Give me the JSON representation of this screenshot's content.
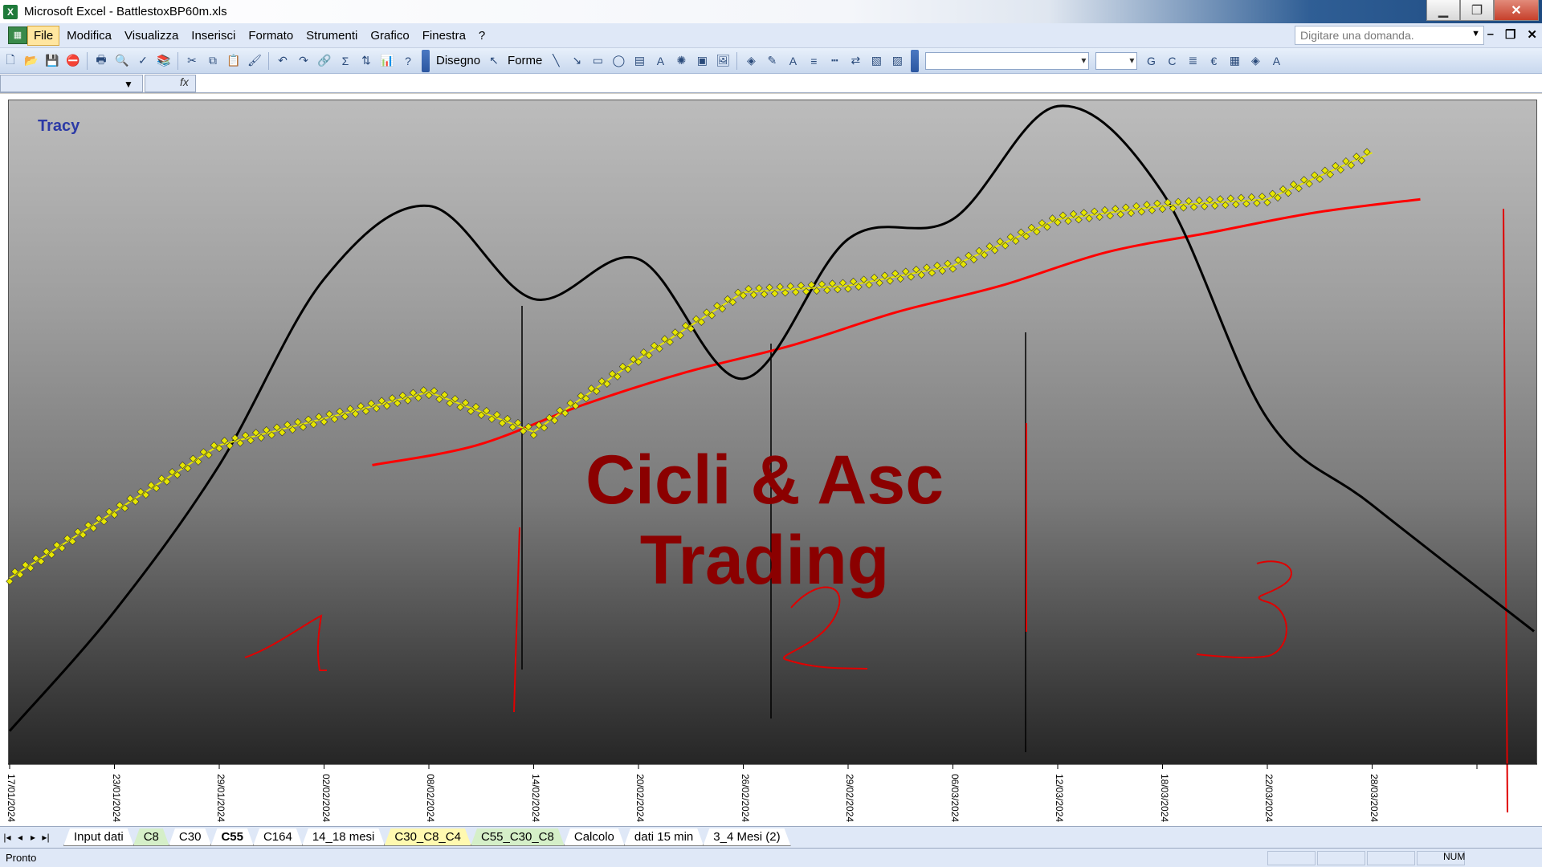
{
  "window": {
    "title": "Microsoft Excel - BattlestoxBP60m.xls",
    "app_icon": "excel-icon"
  },
  "menubar": {
    "items": [
      "File",
      "Modifica",
      "Visualizza",
      "Inserisci",
      "Formato",
      "Strumenti",
      "Grafico",
      "Finestra",
      "?"
    ],
    "ask_placeholder": "Digitare una domanda."
  },
  "toolbar": {
    "draw_label": "Disegno",
    "shapes_label": "Forme"
  },
  "formula": {
    "fx_label": "fx"
  },
  "chart_data": {
    "type": "line",
    "title": "Tracy",
    "watermark_line1": "Cicli & Asc",
    "watermark_line2": "Trading",
    "cycle_labels": [
      "1",
      "2",
      "3"
    ],
    "categories": [
      "17/01/2024",
      "23/01/2024",
      "29/01/2024",
      "02/02/2024",
      "08/02/2024",
      "14/02/2024",
      "20/02/2024",
      "26/02/2024",
      "29/02/2024",
      "06/03/2024",
      "12/03/2024",
      "18/03/2024",
      "22/03/2024",
      "28/03/2024"
    ],
    "series": [
      {
        "name": "",
        "color": "#000000",
        "values": [
          0.05,
          0.23,
          0.45,
          0.73,
          0.84,
          0.7,
          0.76,
          0.58,
          0.79,
          0.82,
          0.99,
          0.86,
          0.52,
          0.39
        ]
      },
      {
        "name": "",
        "color": "#e6e600",
        "values": [
          0.28,
          0.38,
          0.48,
          0.52,
          0.56,
          0.5,
          0.61,
          0.71,
          0.72,
          0.75,
          0.82,
          0.84,
          0.85,
          0.92
        ]
      },
      {
        "name": "",
        "color": "#ff0000",
        "values": [
          null,
          null,
          null,
          0.45,
          0.48,
          0.54,
          0.59,
          0.63,
          0.68,
          0.72,
          0.77,
          0.8,
          0.83,
          0.85
        ]
      }
    ],
    "grid": false,
    "legend": "none",
    "colors": {
      "plot_top": "#bcbcbc",
      "plot_bottom": "#262626",
      "watermark": "#8b0000",
      "title": "#2c3aa6"
    }
  },
  "sheets": {
    "tabs": [
      {
        "label": "Input dati",
        "style": "plain"
      },
      {
        "label": "C8",
        "style": "green"
      },
      {
        "label": "C30",
        "style": "plain"
      },
      {
        "label": "C55",
        "style": "active"
      },
      {
        "label": "C164",
        "style": "plain"
      },
      {
        "label": "14_18 mesi",
        "style": "plain"
      },
      {
        "label": "C30_C8_C4",
        "style": "yellow"
      },
      {
        "label": "C55_C30_C8",
        "style": "green"
      },
      {
        "label": "Calcolo",
        "style": "plain"
      },
      {
        "label": "dati 15 min",
        "style": "plain"
      },
      {
        "label": "3_4 Mesi (2)",
        "style": "plain"
      }
    ]
  },
  "status": {
    "text": "Pronto",
    "num": "NUM"
  }
}
